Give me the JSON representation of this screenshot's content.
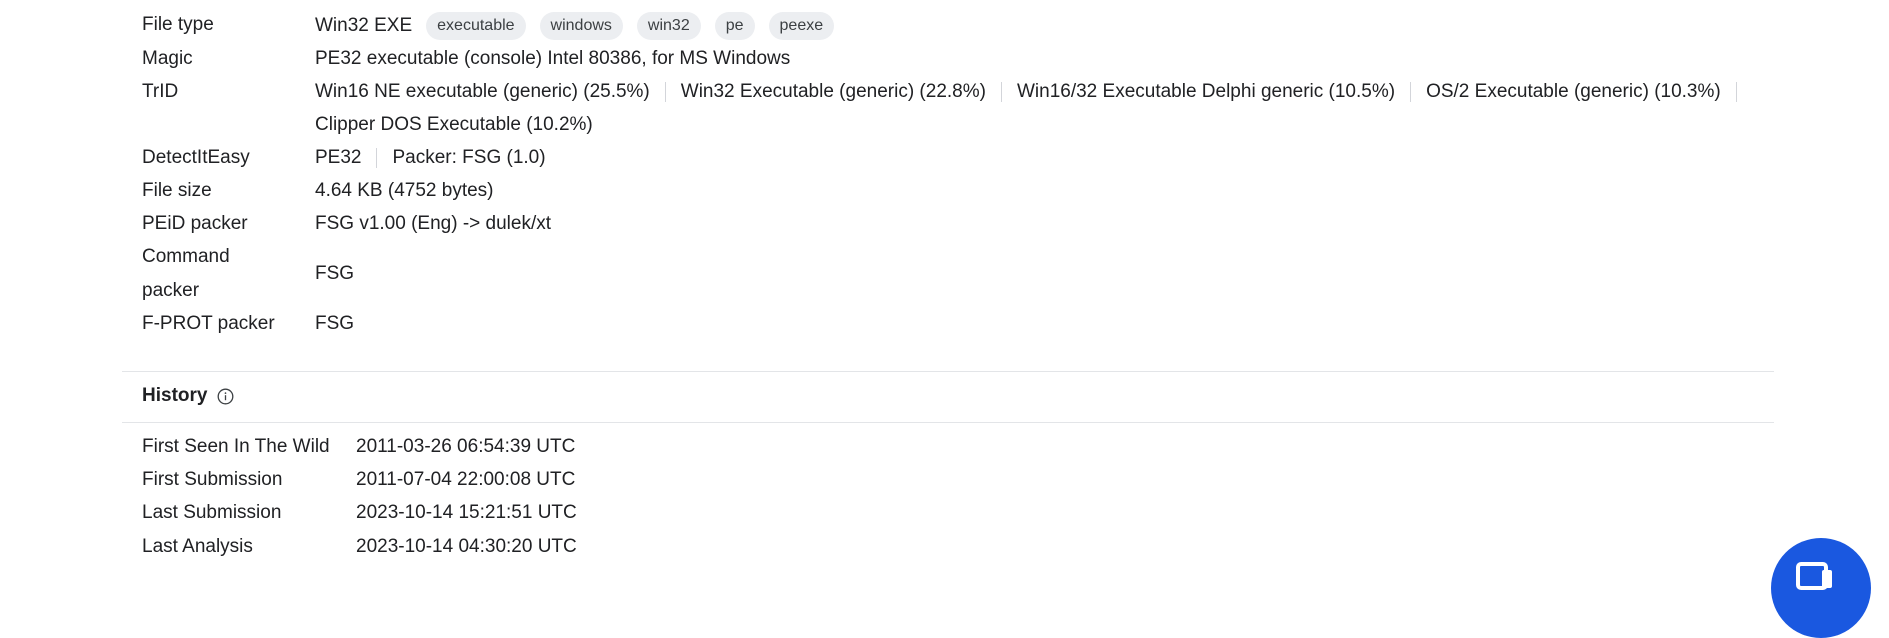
{
  "properties": {
    "file_type": {
      "label": "File type",
      "value": "Win32 EXE",
      "tags": [
        "executable",
        "windows",
        "win32",
        "pe",
        "peexe"
      ]
    },
    "magic": {
      "label": "Magic",
      "value": "PE32 executable (console) Intel 80386, for MS Windows"
    },
    "trid": {
      "label": "TrID",
      "items": [
        "Win16 NE executable (generic) (25.5%)",
        "Win32 Executable (generic) (22.8%)",
        "Win16/32 Executable Delphi generic (10.5%)",
        "OS/2 Executable (generic) (10.3%)",
        "Clipper DOS Executable (10.2%)"
      ]
    },
    "detectiteasy": {
      "label": "DetectItEasy",
      "items": [
        "PE32",
        "Packer: FSG (1.0)"
      ]
    },
    "file_size": {
      "label": "File size",
      "value": "4.64 KB (4752 bytes)"
    },
    "peid_packer": {
      "label": "PEiD packer",
      "value": "FSG v1.00 (Eng) -> dulek/xt"
    },
    "command_packer": {
      "label_line1": "Command",
      "label_line2": "packer",
      "value": "FSG"
    },
    "fprot_packer": {
      "label": "F-PROT packer",
      "value": "FSG"
    }
  },
  "history": {
    "title": "History",
    "info_icon": "info-icon",
    "rows": [
      {
        "label": "First Seen In The Wild",
        "value": "2011-03-26 06:54:39 UTC"
      },
      {
        "label": "First Submission",
        "value": "2011-07-04 22:00:08 UTC"
      },
      {
        "label": "Last Submission",
        "value": "2023-10-14 15:21:51 UTC"
      },
      {
        "label": "Last Analysis",
        "value": "2023-10-14 04:30:20 UTC"
      }
    ]
  },
  "fab": {
    "icon": "chat-icon",
    "color": "#1a58e0"
  }
}
